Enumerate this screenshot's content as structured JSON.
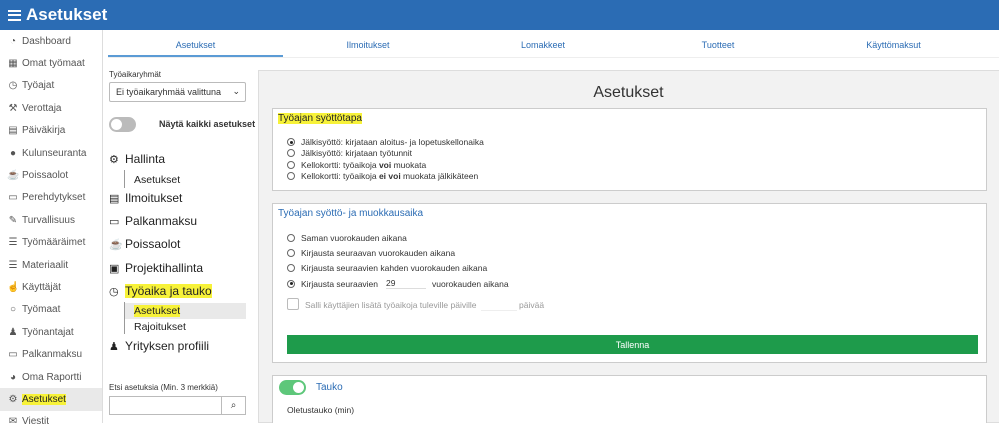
{
  "app": {
    "title": "Asetukset"
  },
  "sidebar": {
    "items": [
      {
        "label": "Dashboard",
        "icon": "dashboard-icon"
      },
      {
        "label": "Omat työmaat",
        "icon": "building-icon"
      },
      {
        "label": "Työajat",
        "icon": "clock-icon"
      },
      {
        "label": "Verottaja",
        "icon": "gavel-icon"
      },
      {
        "label": "Päiväkirja",
        "icon": "book-icon"
      },
      {
        "label": "Kulunseuranta",
        "icon": "pin-icon"
      },
      {
        "label": "Poissaolot",
        "icon": "mug-icon"
      },
      {
        "label": "Perehdytykset",
        "icon": "doc-icon"
      },
      {
        "label": "Turvallisuus",
        "icon": "wrench-icon"
      },
      {
        "label": "Työmääräimet",
        "icon": "list-icon"
      },
      {
        "label": "Materiaalit",
        "icon": "list-icon"
      },
      {
        "label": "Käyttäjät",
        "icon": "thumb-icon"
      },
      {
        "label": "Työmaat",
        "icon": "user-icon"
      },
      {
        "label": "Työnantajat",
        "icon": "user-icon"
      },
      {
        "label": "Palkanmaksu",
        "icon": "doc-icon"
      },
      {
        "label": "Oma Raportti",
        "icon": "chart-icon"
      },
      {
        "label": "Asetukset",
        "icon": "gear-icon"
      },
      {
        "label": "Viestit",
        "icon": "mail-icon"
      }
    ]
  },
  "tabs": [
    "Asetukset",
    "Ilmoitukset",
    "Lomakkeet",
    "Tuotteet",
    "Käyttömaksut"
  ],
  "left_panel": {
    "group_label": "Työaikaryhmät",
    "group_select": "Ei työaikaryhmää valittuna",
    "show_all_label": "Näytä kaikki asetukset",
    "tree": {
      "hallinta": "Hallinta",
      "hallinta_sub": "Asetukset",
      "ilmoitukset": "Ilmoitukset",
      "palkanmaksu": "Palkanmaksu",
      "poissaolot": "Poissaolot",
      "projektihallinta": "Projektihallinta",
      "tyoaika": "Työaika ja tauko",
      "tyoaika_sub1": "Asetukset",
      "tyoaika_sub2": "Rajoitukset",
      "yritys": "Yrityksen profiili"
    },
    "search_label": "Etsi asetuksia (Min. 3 merkkiä)",
    "search_value": ""
  },
  "main": {
    "title": "Asetukset",
    "card1": {
      "title": "Työajan syöttötapa",
      "options": [
        {
          "pre": "Jälkisyöttö: kirjataan aloitus- ja lopetuskellonaika",
          "bold": "",
          "post": "",
          "checked": true
        },
        {
          "pre": "Jälkisyöttö: kirjataan työtunnit",
          "bold": "",
          "post": "",
          "checked": false
        },
        {
          "pre": "Kellokortti: työaikoja ",
          "bold": "voi",
          "post": " muokata",
          "checked": false
        },
        {
          "pre": "Kellokortti: työaikoja ",
          "bold": "ei voi",
          "post": " muokata jälkikäteen",
          "checked": false
        }
      ]
    },
    "card2": {
      "title": "Työajan syöttö- ja muokkausaika",
      "options": [
        {
          "label": "Saman vuorokauden aikana",
          "checked": false
        },
        {
          "label": "Kirjausta seuraavan vuorokauden aikana",
          "checked": false
        },
        {
          "label": "Kirjausta seuraavien kahden vuorokauden aikana",
          "checked": false
        },
        {
          "label": "Kirjausta seuraavien",
          "value": "29",
          "suffix": "vuorokauden aikana",
          "checked": true
        }
      ],
      "future_label": "Salli käyttäjien lisätä työaikoja tuleville päiville",
      "future_suffix": "päivää",
      "save_label": "Tallenna"
    },
    "card3": {
      "toggle_label": "Tauko",
      "default_label": "Oletustauko (min)"
    }
  },
  "colors": {
    "brand": "#2b6cb4",
    "highlight": "#f7f239",
    "save": "#1e9b4b",
    "toggle_on": "#5ec77a"
  }
}
